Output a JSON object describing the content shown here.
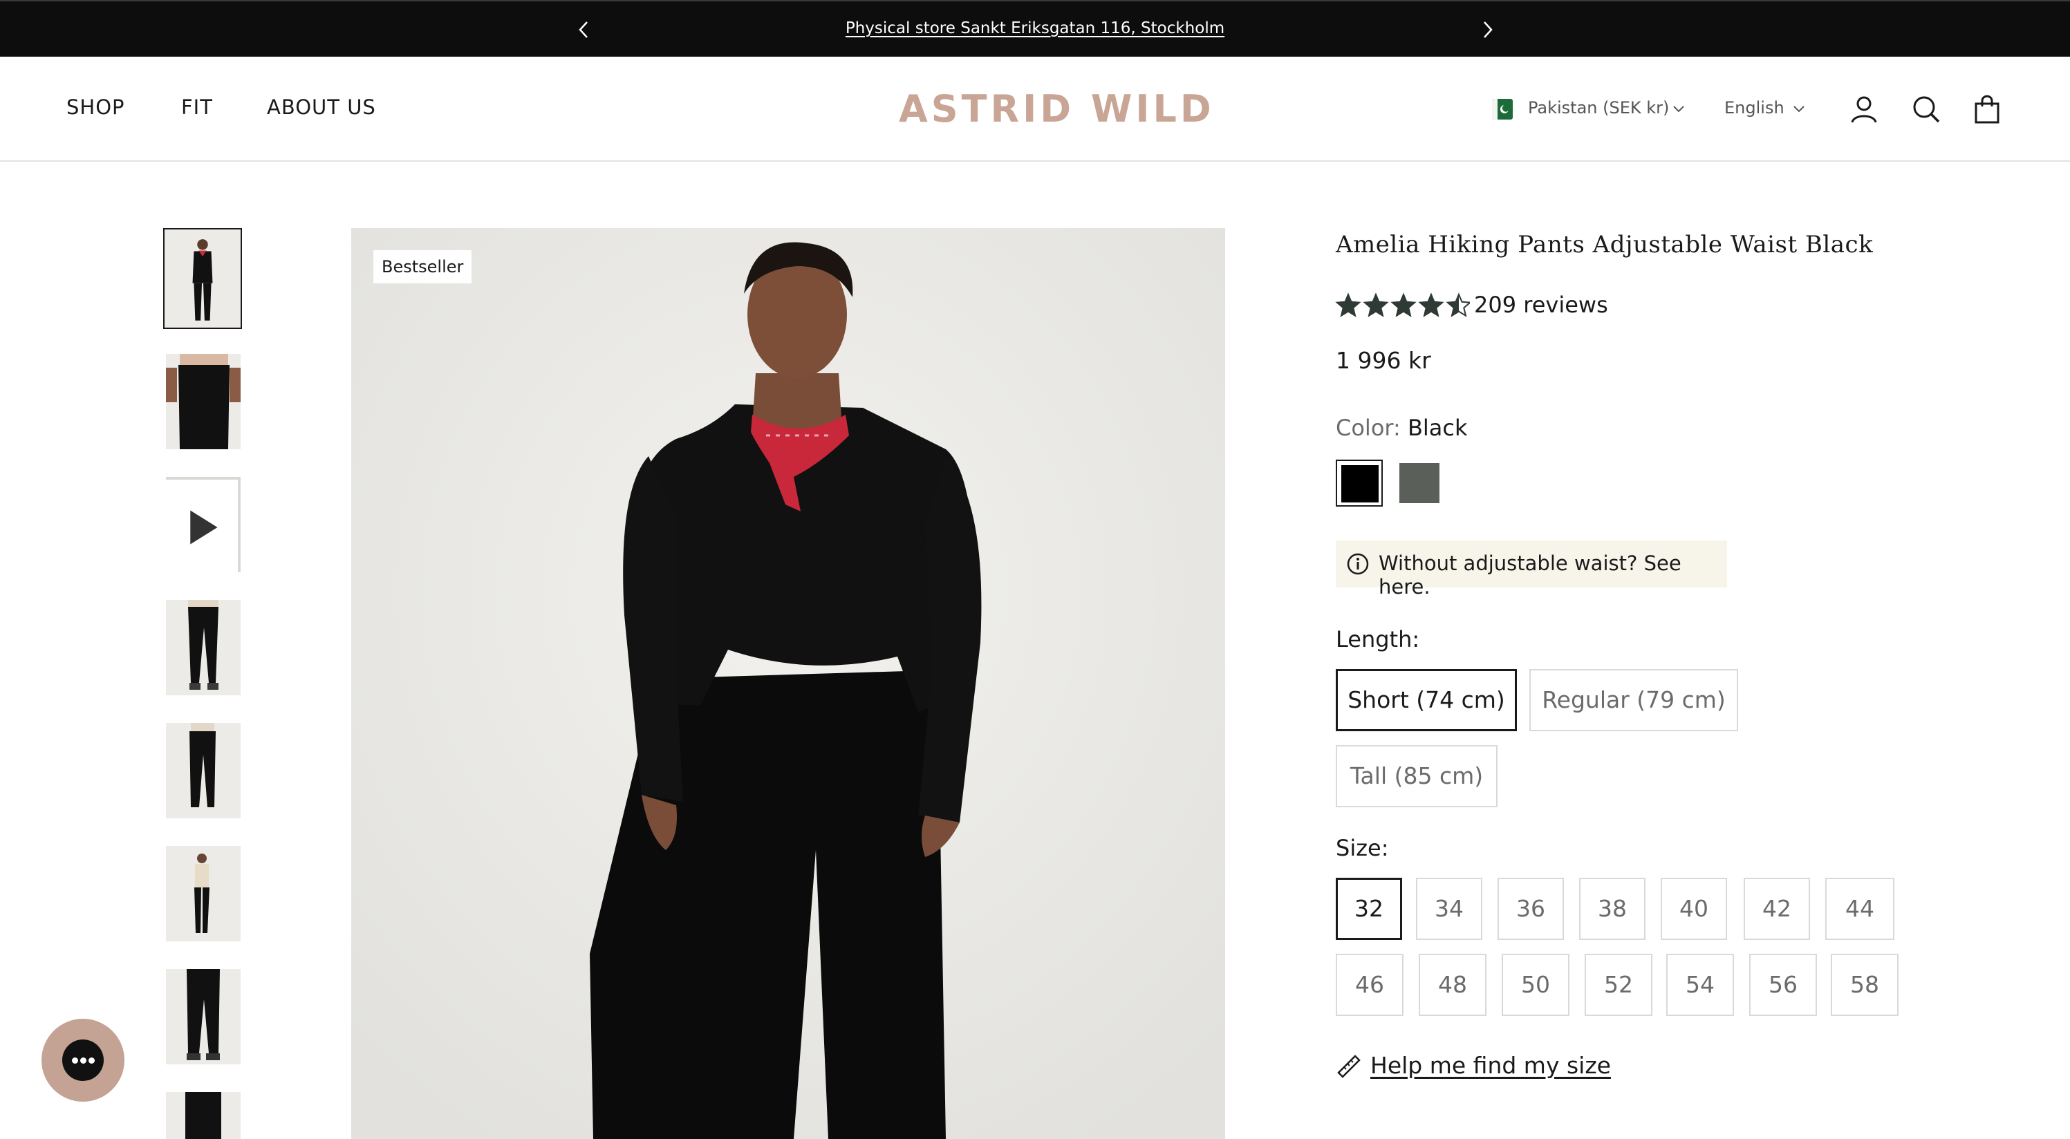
{
  "announcement": {
    "message": "Physical store Sankt Eriksgatan 116, Stockholm",
    "prev_icon": "chevron-left-icon",
    "next_icon": "chevron-right-icon"
  },
  "header": {
    "nav": [
      "SHOP",
      "FIT",
      "ABOUT US"
    ],
    "logo": "ASTRID WILD",
    "country": "Pakistan (SEK kr)",
    "language": "English",
    "icons": [
      "account-icon",
      "search-icon",
      "cart-icon"
    ]
  },
  "gallery": {
    "thumbnail_count": 8,
    "active_thumbnail": 1,
    "video_thumbnail": 3,
    "badge": "Bestseller"
  },
  "product": {
    "title": "Amelia Hiking Pants Adjustable Waist Black",
    "rating": 4.5,
    "rating_max": 5,
    "reviews": "209 reviews",
    "price": "1 996 kr",
    "color_label": "Color:",
    "color_value": "Black",
    "swatches": [
      {
        "name": "Black",
        "hex": "#000000",
        "selected": true
      },
      {
        "name": "Olive green",
        "hex": "#5b5f59",
        "selected": false
      }
    ],
    "note": "Without adjustable waist? See here.",
    "length_label": "Length:",
    "lengths": [
      {
        "label": "Short (74 cm)",
        "selected": true
      },
      {
        "label": "Regular (79 cm)",
        "selected": false
      },
      {
        "label": "Tall (85 cm)",
        "selected": false
      }
    ],
    "size_label": "Size:",
    "sizes": [
      "32",
      "34",
      "36",
      "38",
      "40",
      "42",
      "44",
      "46",
      "48",
      "50",
      "52",
      "54",
      "56",
      "58"
    ],
    "selected_size": "32",
    "help_link": "Help me find my size"
  },
  "colors": {
    "announcement_bg": "#0d0d0d",
    "logo": "#c9a595",
    "star": "#2e3a33",
    "note_bg": "#f7f4ea",
    "chat_bg": "#c4a294"
  }
}
